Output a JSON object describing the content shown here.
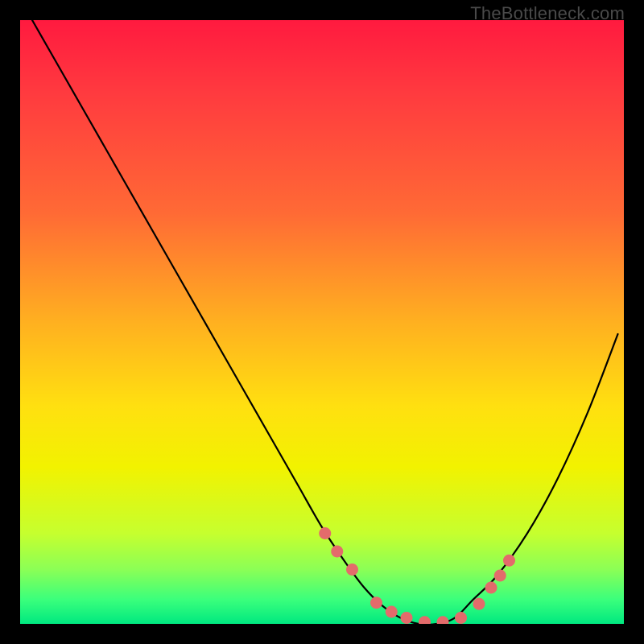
{
  "watermark": {
    "text": "TheBottleneck.com"
  },
  "chart_data": {
    "type": "line",
    "title": "",
    "xlabel": "",
    "ylabel": "",
    "xlim": [
      0,
      100
    ],
    "ylim": [
      0,
      100
    ],
    "series": [
      {
        "name": "bottleneck-curve",
        "x": [
          2,
          6,
          10,
          14,
          18,
          22,
          26,
          30,
          34,
          38,
          42,
          46,
          50,
          54,
          57,
          60,
          63,
          66,
          69,
          72,
          75,
          79,
          84,
          89,
          94,
          99
        ],
        "y": [
          100,
          93,
          86,
          79,
          72,
          65,
          58,
          51,
          44,
          37,
          30,
          23,
          16,
          10,
          6,
          3,
          1,
          0,
          0,
          1,
          4,
          8,
          15,
          24,
          35,
          48
        ]
      }
    ],
    "markers": {
      "name": "highlight-dots",
      "color": "#e36b6b",
      "x": [
        50.5,
        52.5,
        55,
        59,
        61.5,
        64,
        67,
        70,
        73,
        76,
        78,
        79.5,
        81
      ],
      "y": [
        15,
        12,
        9,
        3.5,
        2,
        1,
        0.3,
        0.3,
        1,
        3.3,
        6,
        8,
        10.5
      ]
    },
    "gradient_stops": [
      {
        "pos": 0,
        "color": "#ff1a3f"
      },
      {
        "pos": 32,
        "color": "#ff6a35"
      },
      {
        "pos": 64,
        "color": "#ffe010"
      },
      {
        "pos": 85,
        "color": "#c6ff2e"
      },
      {
        "pos": 100,
        "color": "#00e880"
      }
    ]
  }
}
